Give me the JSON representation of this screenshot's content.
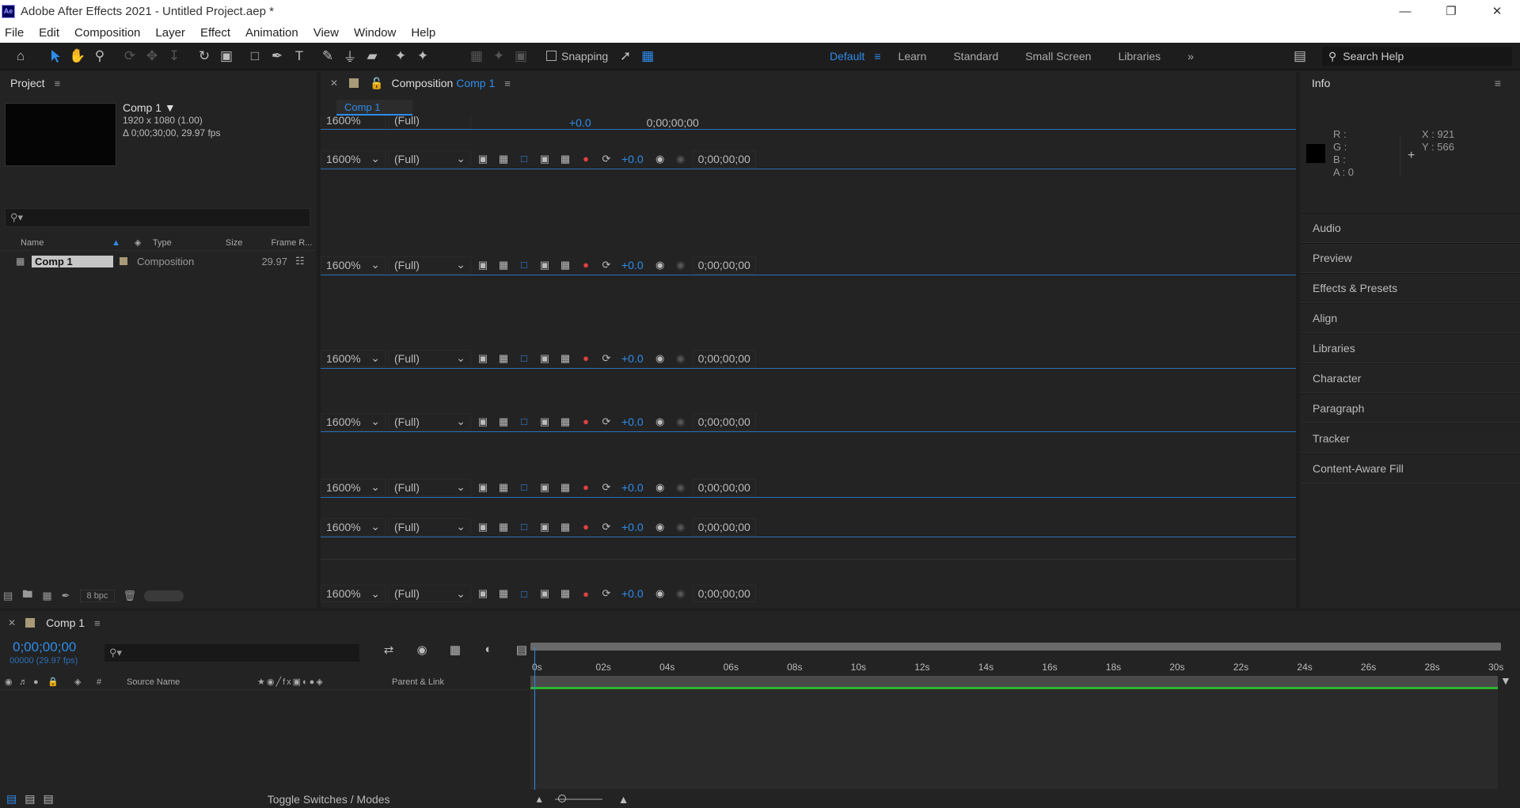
{
  "window": {
    "title": "Adobe After Effects 2021 - Untitled Project.aep *",
    "app_badge": "Ae"
  },
  "menu": [
    "File",
    "Edit",
    "Composition",
    "Layer",
    "Effect",
    "Animation",
    "View",
    "Window",
    "Help"
  ],
  "toolbar": {
    "snapping_label": "Snapping",
    "workspaces": [
      "Default",
      "Learn",
      "Standard",
      "Small Screen",
      "Libraries"
    ],
    "search_placeholder": "Search Help"
  },
  "project": {
    "title": "Project",
    "comp_name": "Comp 1",
    "comp_res": "1920 x 1080 (1.00)",
    "comp_duration": "Δ 0;00;30;00, 29.97 fps",
    "columns": [
      "Name",
      "Type",
      "Size",
      "Frame R..."
    ],
    "items": [
      {
        "name": "Comp 1",
        "type": "Composition",
        "size": "",
        "frame_rate": "29.97"
      }
    ],
    "bpc": "8 bpc"
  },
  "composition": {
    "panel_label": "Composition",
    "comp_name": "Comp 1",
    "tab": "Comp 1",
    "viewer_rows": [
      {
        "zoom": "1600%",
        "resolution": "(Full)",
        "exposure": "+0.0",
        "timecode": "0;00;00;00"
      },
      {
        "zoom": "1600%",
        "resolution": "(Full)",
        "exposure": "+0.0",
        "timecode": "0;00;00;00"
      },
      {
        "zoom": "1600%",
        "resolution": "(Full)",
        "exposure": "+0.0",
        "timecode": "0;00;00;00"
      },
      {
        "zoom": "1600%",
        "resolution": "(Full)",
        "exposure": "+0.0",
        "timecode": "0;00;00;00"
      },
      {
        "zoom": "1600%",
        "resolution": "(Full)",
        "exposure": "+0.0",
        "timecode": "0;00;00;00"
      },
      {
        "zoom": "1600%",
        "resolution": "(Full)",
        "exposure": "+0.0",
        "timecode": "0;00;00;00"
      },
      {
        "zoom": "1600%",
        "resolution": "(Full)",
        "exposure": "+0.0",
        "timecode": "0;00;00;00"
      },
      {
        "zoom": "1600%",
        "resolution": "(Full)",
        "exposure": "+0.0",
        "timecode": "0;00;00;00"
      }
    ]
  },
  "info": {
    "title": "Info",
    "r": "R :",
    "g": "G :",
    "b": "B :",
    "a": "A : 0",
    "x": "X : 921",
    "y": "Y : 566"
  },
  "panels": [
    "Audio",
    "Preview",
    "Effects & Presets",
    "Align",
    "Libraries",
    "Character",
    "Paragraph",
    "Tracker",
    "Content-Aware Fill"
  ],
  "timeline": {
    "comp_name": "Comp 1",
    "timecode": "0;00;00;00",
    "frames": "00000 (29.97 fps)",
    "layer_columns": {
      "num": "#",
      "source": "Source Name",
      "parent": "Parent & Link"
    },
    "ticks": [
      "0s",
      "02s",
      "04s",
      "06s",
      "08s",
      "10s",
      "12s",
      "14s",
      "16s",
      "18s",
      "20s",
      "22s",
      "24s",
      "26s",
      "28s",
      "30s"
    ],
    "toggle_label": "Toggle Switches / Modes"
  },
  "colors": {
    "accent": "#2d8ceb",
    "panel_bg": "#232323",
    "green_bar": "#2fb52f"
  }
}
